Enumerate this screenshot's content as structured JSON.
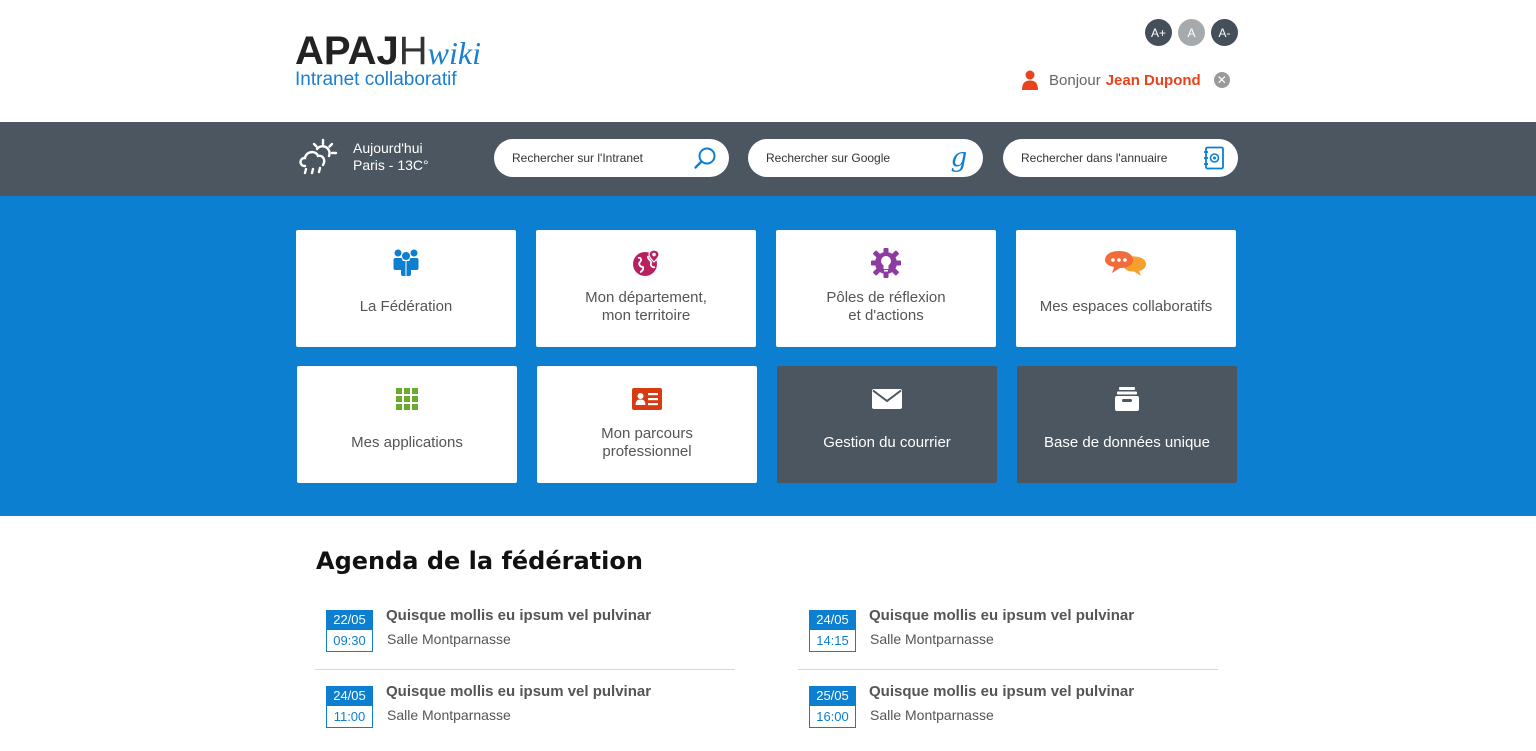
{
  "header": {
    "logo_main": "APAJ",
    "logo_h": "H",
    "logo_wiki": "wiki",
    "logo_subtitle": "Intranet collaboratif",
    "font_sizes": [
      "A+",
      "A",
      "A-"
    ],
    "greeting": "Bonjour",
    "user_name": "Jean Dupond",
    "logout_symbol": "✕"
  },
  "topbar": {
    "weather_line1": "Aujourd'hui",
    "weather_line2": "Paris - 13C°",
    "search_intranet": "Rechercher sur l'Intranet",
    "search_google": "Rechercher sur Google",
    "search_annuaire": "Rechercher dans l'annuaire",
    "google_icon_text": "g"
  },
  "tiles": [
    {
      "label": "La Fédération",
      "icon": "people-icon"
    },
    {
      "label": "Mon département,\nmon territoire",
      "icon": "globe-pin-icon"
    },
    {
      "label": "Pôles de réflexion\net d'actions",
      "icon": "gear-bulb-icon"
    },
    {
      "label": "Mes espaces collaboratifs",
      "icon": "chat-bubbles-icon"
    },
    {
      "label": "Mes applications",
      "icon": "apps-grid-icon"
    },
    {
      "label": "Mon parcours\nprofessionnel",
      "icon": "id-card-icon"
    },
    {
      "label": "Gestion du courrier",
      "icon": "envelope-icon"
    },
    {
      "label": "Base de données unique",
      "icon": "archive-box-icon"
    }
  ],
  "agenda": {
    "title": "Agenda de la fédération",
    "events": [
      {
        "date": "22/05",
        "time": "09:30",
        "title": "Quisque mollis eu ipsum vel pulvinar",
        "place": "Salle Montparnasse"
      },
      {
        "date": "24/05",
        "time": "14:15",
        "title": "Quisque mollis eu ipsum vel pulvinar",
        "place": "Salle Montparnasse"
      },
      {
        "date": "24/05",
        "time": "11:00",
        "title": "Quisque mollis eu ipsum vel pulvinar",
        "place": "Salle Montparnasse"
      },
      {
        "date": "25/05",
        "time": "16:00",
        "title": "Quisque mollis eu ipsum vel pulvinar",
        "place": "Salle Montparnasse"
      }
    ]
  },
  "colors": {
    "brand_blue": "#0d7fd0",
    "dark_slate": "#4b5660",
    "accent_orange": "#e8431c",
    "icon_purple": "#8e3aa0",
    "icon_magenta": "#b8205f",
    "icon_green": "#6aab2e",
    "icon_red": "#d93a12"
  }
}
